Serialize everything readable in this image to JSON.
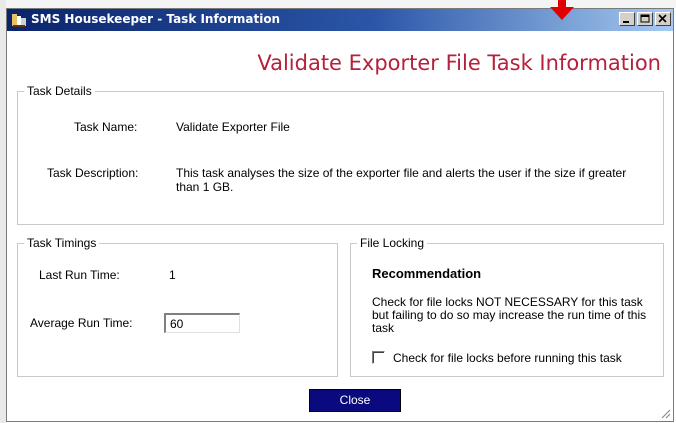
{
  "window": {
    "title": "SMS Housekeeper - Task Information",
    "buttons": [
      "minimize-icon",
      "maximize-icon",
      "close-icon"
    ]
  },
  "heading": "Validate Exporter File Task Information",
  "task_details": {
    "legend": "Task Details",
    "name_label": "Task Name:",
    "name_value": "Validate Exporter File",
    "description_label": "Task Description:",
    "description_value": "This task analyses the size of the exporter file and alerts the user if the size if greater than 1 GB."
  },
  "task_timings": {
    "legend": "Task Timings",
    "last_run_label": "Last Run Time:",
    "last_run_value": "1",
    "average_run_label": "Average Run Time:",
    "average_run_value": "60"
  },
  "file_locking": {
    "legend": "File Locking",
    "recommendation_title": "Recommendation",
    "recommendation_text": "Check for file locks NOT NECESSARY for this task but failing to do so may increase the run time of this task",
    "checkbox_label": "Check for file locks before running this task",
    "checkbox_checked": false
  },
  "close_button": "Close",
  "colors": {
    "heading": "#b5203a",
    "close_button": "#0a0a7e",
    "titlebar": "#0a246a",
    "annotation_arrow": "#e00000"
  }
}
